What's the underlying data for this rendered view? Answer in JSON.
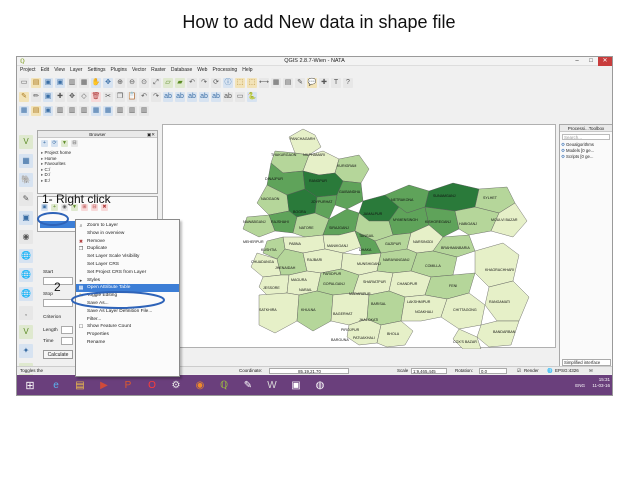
{
  "slide": {
    "title": "How to add New data in shape file",
    "annotation_1": "1- Right click",
    "annotation_2": "2"
  },
  "window": {
    "title": "QGIS 2.8.7-Wien - NATA",
    "minimize": "–",
    "maximize": "□",
    "close": "✕"
  },
  "menubar": [
    "Project",
    "Edit",
    "View",
    "Layer",
    "Settings",
    "Plugins",
    "Vector",
    "Raster",
    "Database",
    "Web",
    "Processing",
    "Help"
  ],
  "browser_panel": {
    "title": "Browser",
    "items": [
      "Project home",
      "Home",
      "Favourites",
      "C:/",
      "D:/",
      "E:/"
    ]
  },
  "context_menu": {
    "items": [
      {
        "label": "Zoom to Layer",
        "icon": "⌕"
      },
      {
        "label": "Show in overview",
        "icon": ""
      },
      {
        "label": "Remove",
        "icon": "✖"
      },
      {
        "label": "Duplicate",
        "icon": "❐"
      },
      {
        "label": "Set Layer Scale Visibility",
        "icon": ""
      },
      {
        "label": "Set Layer CRS",
        "icon": ""
      },
      {
        "label": "Set Project CRS from Layer",
        "icon": ""
      },
      {
        "label": "Styles",
        "icon": "▸"
      },
      {
        "label": "Open Attribute Table",
        "icon": "▦"
      },
      {
        "label": "Toggle Editing",
        "icon": "✎"
      },
      {
        "label": "Save As...",
        "icon": ""
      },
      {
        "label": "Save As Layer Definition File...",
        "icon": ""
      },
      {
        "label": "Filter...",
        "icon": ""
      },
      {
        "label": "Show Feature Count",
        "icon": "☐"
      },
      {
        "label": "Properties",
        "icon": ""
      },
      {
        "label": "Rename",
        "icon": ""
      }
    ],
    "selected_index": 8
  },
  "left_panel_lower": {
    "start_label": "Start",
    "stop_label": "Stop",
    "criterion_label": "Criterion",
    "length_label": "Length",
    "time_label": "Time",
    "calculate_button": "Calculate"
  },
  "map": {
    "labels": [
      "PANCHAGARH",
      "THAKURGAON",
      "NILPHAMARI",
      "KURIGRAM",
      "DINAJPUR",
      "RANGPUR",
      "GAIBANDHA",
      "JOYPURHAT",
      "NAOGAON",
      "SUNAMGANJ",
      "SYLHET",
      "NAWABGANJ",
      "RAJSHAHI",
      "BOGRA",
      "NETRAKONA",
      "JAMALPUR",
      "MYMENSINGH",
      "NATORE",
      "SIRAJGANJ",
      "KISHOREGANJ",
      "HABIGANJ",
      "MOULVI BAZAR",
      "PABNA",
      "TANGAIL",
      "GAZIPUR",
      "KUSHTIA",
      "MEHERPUR",
      "MANIKGANJ",
      "DHAKA",
      "NARSINGDI",
      "CHUADANGA",
      "RAJBARI",
      "JHENAIDAH",
      "MAGURA",
      "FARIDPUR",
      "MUNSHIGANJ",
      "NARAYANGANJ",
      "BRAHMANBARIA",
      "JESSORE",
      "NARAIL",
      "GOPALGANJ",
      "SHARIATPUR",
      "CHANDPUR",
      "COMILLA",
      "SATKHIRA",
      "KHULNA",
      "BAGERHAT",
      "MADARIPUR",
      "BARISAL",
      "LAKSHMIPUR",
      "NOAKHALI",
      "FENI",
      "KHAGRACHHARI",
      "RANGAMATI",
      "CHITTAGONG",
      "BANDARBAN",
      "COX'S BAZAR",
      "PIROJPUR",
      "JHALOKATI",
      "PATUAKHALI",
      "BARGUNA",
      "BHOLA"
    ]
  },
  "processing_toolbox": {
    "title": "Processi...Toolbox",
    "search_placeholder": "Search...",
    "items": [
      "Geoalgorithms",
      "Models [0 ge...",
      "Scripts [0 ge..."
    ],
    "interface": "Simplified interface"
  },
  "statusbar": {
    "left_text": "Toggles the",
    "coordinate_label": "Coordinate:",
    "coordinate_value": "85.19,21.70",
    "scale_label": "Scale",
    "scale_value": "1:9,465,445",
    "rotation_label": "Rotation:",
    "rotation_value": "0.0",
    "render_label": "Render",
    "crs_label": "EPSG:4326"
  },
  "taskbar": {
    "lang": "ENG",
    "time": "15:31",
    "date": "11-03-16"
  },
  "colors": {
    "dark_green": "#2a7a3a",
    "mid_green": "#5fa35a",
    "light_green": "#b5d69a",
    "pale_green": "#e6f0c8",
    "annotation_blue": "#2e63b8",
    "selection_blue": "#3c7ed6",
    "taskbar_purple": "#6a3f7c"
  }
}
